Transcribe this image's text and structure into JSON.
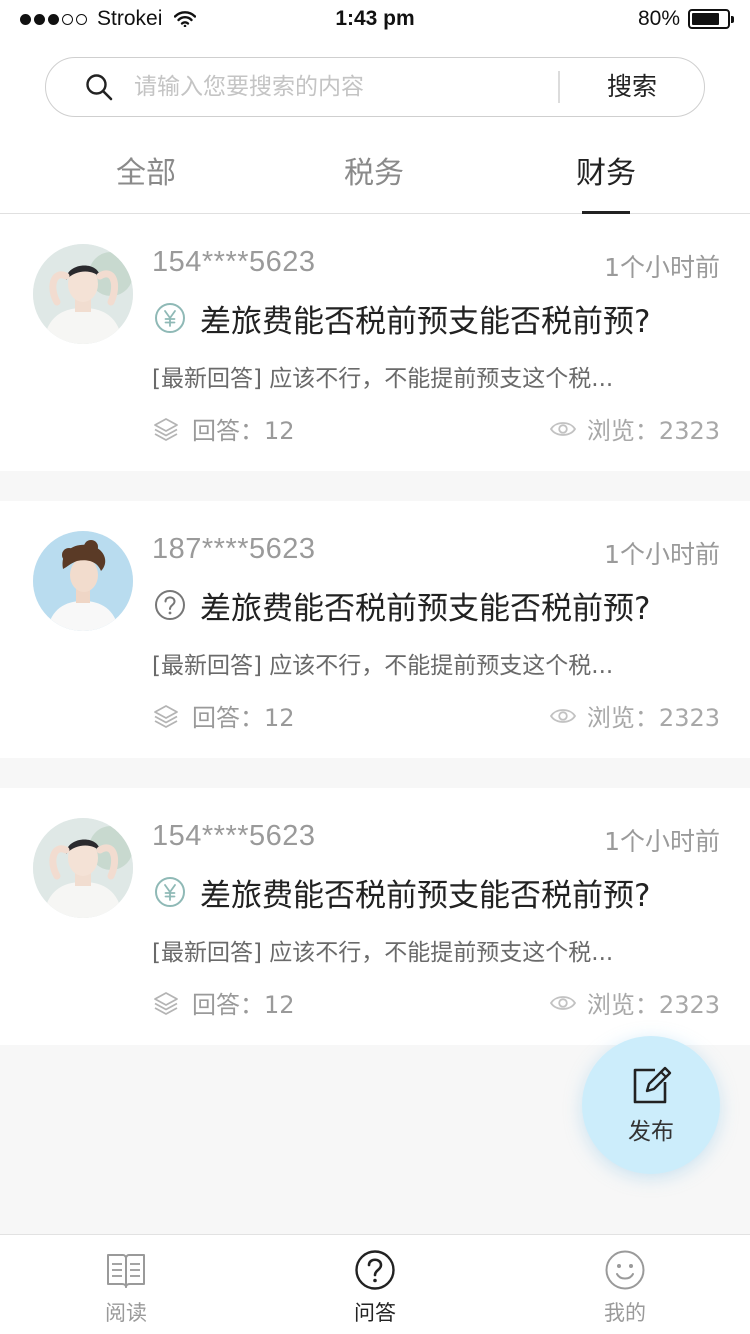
{
  "status_bar": {
    "carrier": "Strokei",
    "time": "1:43 pm",
    "battery": "80%",
    "battery_level": 0.8,
    "signal_bars_filled": 3,
    "signal_bars_total": 5
  },
  "search": {
    "placeholder": "请输入您要搜索的内容",
    "value": "",
    "button_label": "搜索"
  },
  "tabs": [
    {
      "label": "全部",
      "active": false
    },
    {
      "label": "税务",
      "active": false
    },
    {
      "label": "财务",
      "active": true
    }
  ],
  "questions": [
    {
      "username": "154****5623",
      "time": "1个小时前",
      "icon": "yuan-icon",
      "title": "差旅费能否税前预支能否税前预?",
      "latest_answer": "[最新回答] 应该不行，不能提前预支这个税...",
      "answers_label": "回答：12",
      "views_label": "浏览：2323"
    },
    {
      "username": "187****5623",
      "time": "1个小时前",
      "icon": "question-icon",
      "title": "差旅费能否税前预支能否税前预?",
      "latest_answer": "[最新回答] 应该不行，不能提前预支这个税...",
      "answers_label": "回答：12",
      "views_label": "浏览：2323"
    },
    {
      "username": "154****5623",
      "time": "1个小时前",
      "icon": "yuan-icon",
      "title": "差旅费能否税前预支能否税前预?",
      "latest_answer": "[最新回答] 应该不行，不能提前预支这个税...",
      "answers_label": "回答：12",
      "views_label": "浏览：2323"
    }
  ],
  "fab": {
    "label": "发布",
    "icon": "edit-icon"
  },
  "bottom_nav": [
    {
      "label": "阅读",
      "icon": "book-icon",
      "active": false
    },
    {
      "label": "问答",
      "icon": "question-circle-icon",
      "active": true
    },
    {
      "label": "我的",
      "icon": "smiley-icon",
      "active": false
    }
  ],
  "colors": {
    "fab_background": "#ccedfb",
    "yuan_icon": "#8fb9b6",
    "active_text": "#222222",
    "muted_text": "#9a9a9a"
  }
}
